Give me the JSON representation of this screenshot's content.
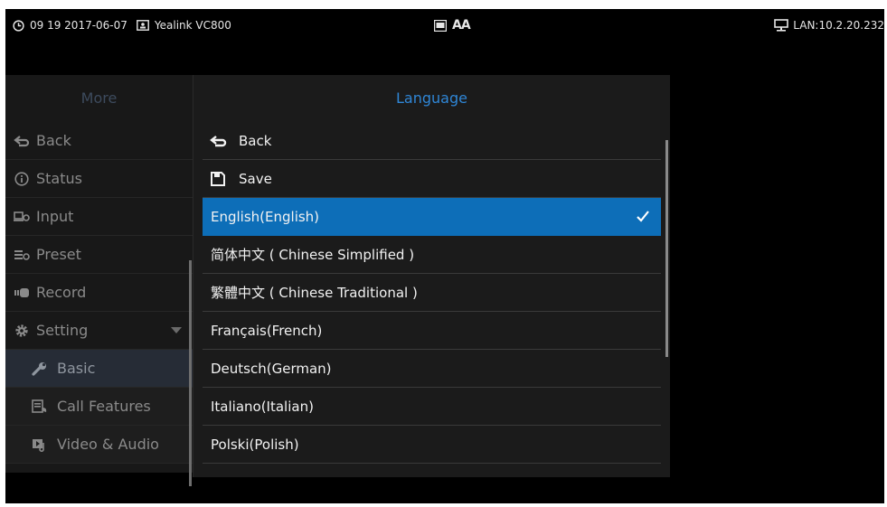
{
  "statusbar": {
    "datetime": "09 19 2017-06-07",
    "device": "Yealink VC800",
    "font_indicator": "AA",
    "network": "LAN:10.2.20.232"
  },
  "left_menu": {
    "title": "More",
    "items": [
      {
        "label": "Back",
        "icon": "back-arrow-icon"
      },
      {
        "label": "Status",
        "icon": "info-icon"
      },
      {
        "label": "Input",
        "icon": "input-icon"
      },
      {
        "label": "Preset",
        "icon": "preset-icon"
      },
      {
        "label": "Record",
        "icon": "record-icon"
      },
      {
        "label": "Setting",
        "icon": "gear-icon"
      },
      {
        "label": "Basic",
        "icon": "wrench-icon"
      },
      {
        "label": "Call Features",
        "icon": "call-features-icon"
      },
      {
        "label": "Video & Audio",
        "icon": "video-audio-icon"
      }
    ]
  },
  "dialog": {
    "title": "Language",
    "back_label": "Back",
    "save_label": "Save",
    "languages": [
      "English(English)",
      "简体中文 ( Chinese Simplified )",
      "繁體中文 ( Chinese Traditional )",
      "Français(French)",
      "Deutsch(German)",
      "Italiano(Italian)",
      "Polski(Polish)"
    ],
    "selected": "English(English)"
  },
  "colors": {
    "accent": "#0d6eb8",
    "title": "#2f86d6",
    "background": "#000000"
  }
}
